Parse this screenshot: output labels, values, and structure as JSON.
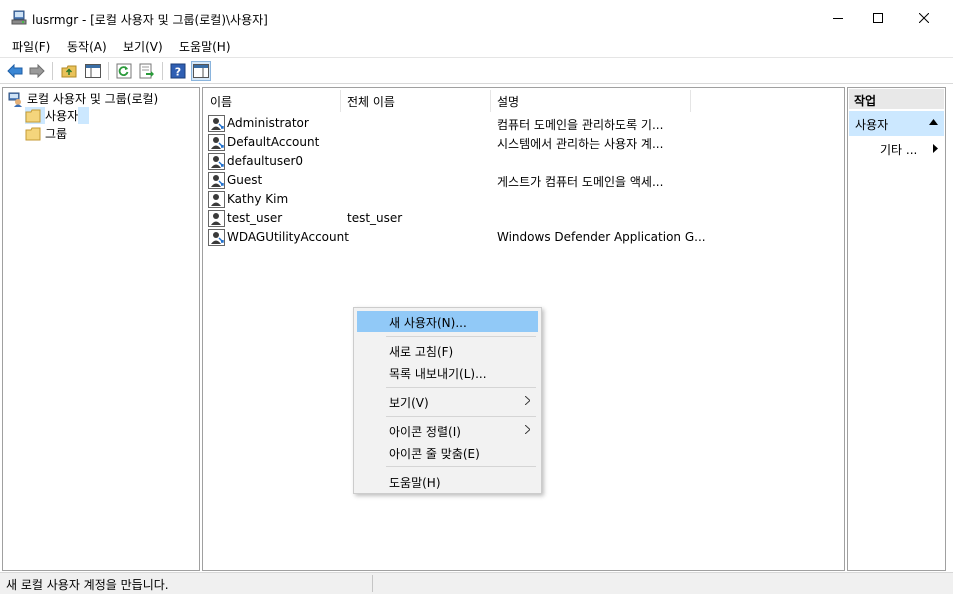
{
  "window": {
    "title": "lusrmgr - [로컬 사용자 및 그룹(로컬)\\사용자]",
    "minimize_icon": "minimize-icon",
    "maximize_icon": "maximize-icon",
    "close_icon": "close-icon"
  },
  "menubar": {
    "items": [
      "파일(F)",
      "동작(A)",
      "보기(V)",
      "도움말(H)"
    ]
  },
  "toolbar": {
    "buttons": [
      "back-arrow-icon",
      "forward-arrow-icon",
      "up-folder-icon",
      "show-hide-tree-icon",
      "refresh-icon",
      "export-list-icon",
      "help-icon",
      "show-hide-action-pane-icon"
    ]
  },
  "tree": {
    "root": "로컬 사용자 및 그룹(로컬)",
    "children": [
      {
        "label": "사용자",
        "selected": true
      },
      {
        "label": "그룹",
        "selected": false
      }
    ]
  },
  "list": {
    "columns": [
      "이름",
      "전체 이름",
      "설명"
    ],
    "rows": [
      {
        "name": "Administrator",
        "full_name": "",
        "description": "컴퓨터 도메인을 관리하도록 기..."
      },
      {
        "name": "DefaultAccount",
        "full_name": "",
        "description": "시스템에서 관리하는 사용자 계..."
      },
      {
        "name": "defaultuser0",
        "full_name": "",
        "description": ""
      },
      {
        "name": "Guest",
        "full_name": "",
        "description": "게스트가 컴퓨터 도메인을 액세..."
      },
      {
        "name": "Kathy Kim",
        "full_name": "",
        "description": ""
      },
      {
        "name": "test_user",
        "full_name": "test_user",
        "description": ""
      },
      {
        "name": "WDAGUtilityAccount",
        "full_name": "",
        "description": "Windows Defender Application G..."
      }
    ]
  },
  "actions": {
    "header": "작업",
    "section": "사용자",
    "more": "기타 ..."
  },
  "context_menu": {
    "items": [
      {
        "label": "새 사용자(N)...",
        "highlighted": true
      },
      {
        "label": "새로 고침(F)"
      },
      {
        "label": "목록 내보내기(L)..."
      },
      {
        "label": "보기(V)",
        "submenu": true
      },
      {
        "label": "아이콘 정렬(I)",
        "submenu": true
      },
      {
        "label": "아이콘 줄 맞춤(E)"
      },
      {
        "label": "도움말(H)"
      }
    ]
  },
  "statusbar": {
    "text": "새 로컬 사용자 계정을 만듭니다."
  },
  "colors": {
    "selection": "#cce8ff",
    "menu_highlight": "#91c9f7",
    "border": "#a0a0a0"
  }
}
